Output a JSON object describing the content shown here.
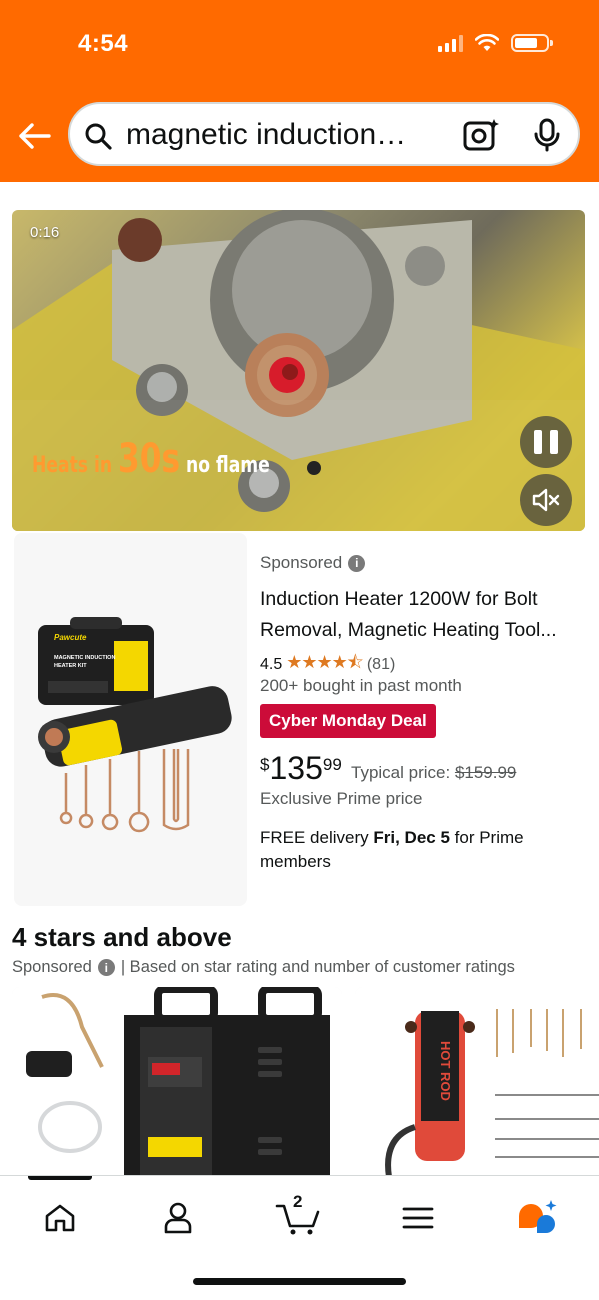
{
  "status_bar": {
    "time": "4:54"
  },
  "header": {
    "search_query": "magnetic induction…",
    "colors": {
      "brand_orange": "#ff6a00"
    },
    "icons": [
      "back-arrow-icon",
      "search-icon",
      "camera-lens-icon",
      "microphone-icon"
    ]
  },
  "video": {
    "timestamp": "0:16",
    "caption_a": "Heats in ",
    "caption_b": "30s",
    "caption_c": " no flame"
  },
  "product": {
    "sponsored_label": "Sponsored",
    "title": "Induction Heater 1200W for Bolt Removal, Magnetic Heating Tool...",
    "rating": "4.5",
    "stars_display": "★★★★⯪",
    "rating_count": "(81)",
    "bought": "200+ bought in past month",
    "deal_badge": "Cyber Monday Deal",
    "price_symbol": "$",
    "price_whole": "135",
    "price_fraction": "99",
    "typical_label": "Typical price: ",
    "typical_price": "$159.99",
    "exclusive": "Exclusive Prime price",
    "delivery_prefix": "FREE delivery ",
    "delivery_date": "Fri, Dec 5",
    "delivery_suffix": " for Prime members",
    "image_brand": "Pawcute",
    "image_kit_line1": "MAGNETIC INDUCTION",
    "image_kit_line2": "HEATER KIT",
    "colors": {
      "deal_red": "#cc0c39",
      "star_orange": "#de7921"
    }
  },
  "section": {
    "title": "4 stars and above",
    "sponsored_label": "Sponsored",
    "subtitle": "| Based on star rating and number of customer ratings",
    "card3_label": "HOT ROD"
  },
  "bottom_nav": {
    "cart_count": "2",
    "items": [
      "home-icon",
      "account-icon",
      "cart-icon",
      "menu-icon",
      "rufus-ai-icon"
    ]
  }
}
